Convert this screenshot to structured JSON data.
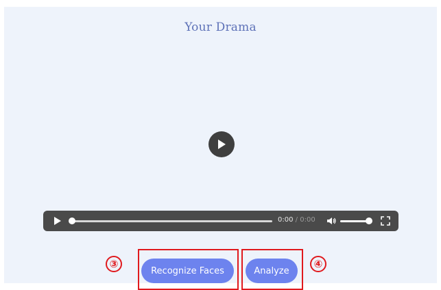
{
  "page": {
    "title": "Your Drama"
  },
  "video_player": {
    "current_time": "0:00",
    "separator": "/",
    "duration": "0:00",
    "progress": 0.0,
    "volume": 1.0,
    "icons": {
      "big_play": "play-circle-icon",
      "play": "play-icon",
      "volume": "volume-icon",
      "fullscreen": "fullscreen-icon"
    }
  },
  "buttons": {
    "recognize_faces": "Recognize Faces",
    "analyze": "Analyze"
  },
  "annotations": {
    "marker_3": "③",
    "marker_4": "④"
  },
  "colors": {
    "background": "#eef3fb",
    "title": "#5e72b8",
    "button": "#6d83ee",
    "annotation": "#e0191d",
    "player_bar": "#4a4a4a"
  }
}
